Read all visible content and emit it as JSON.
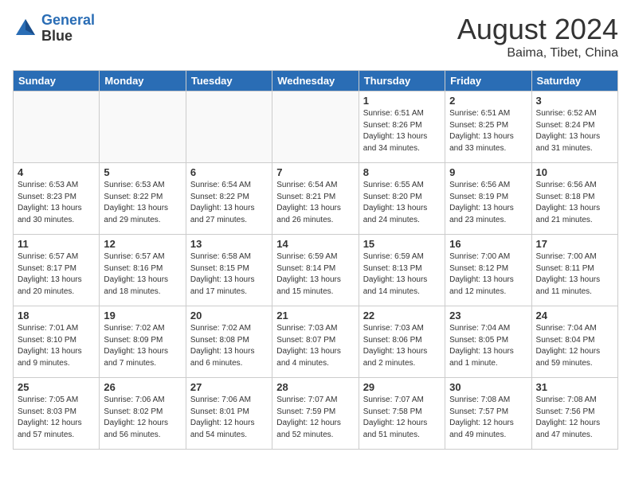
{
  "header": {
    "logo_line1": "General",
    "logo_line2": "Blue",
    "month_year": "August 2024",
    "location": "Baima, Tibet, China"
  },
  "weekdays": [
    "Sunday",
    "Monday",
    "Tuesday",
    "Wednesday",
    "Thursday",
    "Friday",
    "Saturday"
  ],
  "weeks": [
    [
      {
        "day": "",
        "info": ""
      },
      {
        "day": "",
        "info": ""
      },
      {
        "day": "",
        "info": ""
      },
      {
        "day": "",
        "info": ""
      },
      {
        "day": "1",
        "info": "Sunrise: 6:51 AM\nSunset: 8:26 PM\nDaylight: 13 hours\nand 34 minutes."
      },
      {
        "day": "2",
        "info": "Sunrise: 6:51 AM\nSunset: 8:25 PM\nDaylight: 13 hours\nand 33 minutes."
      },
      {
        "day": "3",
        "info": "Sunrise: 6:52 AM\nSunset: 8:24 PM\nDaylight: 13 hours\nand 31 minutes."
      }
    ],
    [
      {
        "day": "4",
        "info": "Sunrise: 6:53 AM\nSunset: 8:23 PM\nDaylight: 13 hours\nand 30 minutes."
      },
      {
        "day": "5",
        "info": "Sunrise: 6:53 AM\nSunset: 8:22 PM\nDaylight: 13 hours\nand 29 minutes."
      },
      {
        "day": "6",
        "info": "Sunrise: 6:54 AM\nSunset: 8:22 PM\nDaylight: 13 hours\nand 27 minutes."
      },
      {
        "day": "7",
        "info": "Sunrise: 6:54 AM\nSunset: 8:21 PM\nDaylight: 13 hours\nand 26 minutes."
      },
      {
        "day": "8",
        "info": "Sunrise: 6:55 AM\nSunset: 8:20 PM\nDaylight: 13 hours\nand 24 minutes."
      },
      {
        "day": "9",
        "info": "Sunrise: 6:56 AM\nSunset: 8:19 PM\nDaylight: 13 hours\nand 23 minutes."
      },
      {
        "day": "10",
        "info": "Sunrise: 6:56 AM\nSunset: 8:18 PM\nDaylight: 13 hours\nand 21 minutes."
      }
    ],
    [
      {
        "day": "11",
        "info": "Sunrise: 6:57 AM\nSunset: 8:17 PM\nDaylight: 13 hours\nand 20 minutes."
      },
      {
        "day": "12",
        "info": "Sunrise: 6:57 AM\nSunset: 8:16 PM\nDaylight: 13 hours\nand 18 minutes."
      },
      {
        "day": "13",
        "info": "Sunrise: 6:58 AM\nSunset: 8:15 PM\nDaylight: 13 hours\nand 17 minutes."
      },
      {
        "day": "14",
        "info": "Sunrise: 6:59 AM\nSunset: 8:14 PM\nDaylight: 13 hours\nand 15 minutes."
      },
      {
        "day": "15",
        "info": "Sunrise: 6:59 AM\nSunset: 8:13 PM\nDaylight: 13 hours\nand 14 minutes."
      },
      {
        "day": "16",
        "info": "Sunrise: 7:00 AM\nSunset: 8:12 PM\nDaylight: 13 hours\nand 12 minutes."
      },
      {
        "day": "17",
        "info": "Sunrise: 7:00 AM\nSunset: 8:11 PM\nDaylight: 13 hours\nand 11 minutes."
      }
    ],
    [
      {
        "day": "18",
        "info": "Sunrise: 7:01 AM\nSunset: 8:10 PM\nDaylight: 13 hours\nand 9 minutes."
      },
      {
        "day": "19",
        "info": "Sunrise: 7:02 AM\nSunset: 8:09 PM\nDaylight: 13 hours\nand 7 minutes."
      },
      {
        "day": "20",
        "info": "Sunrise: 7:02 AM\nSunset: 8:08 PM\nDaylight: 13 hours\nand 6 minutes."
      },
      {
        "day": "21",
        "info": "Sunrise: 7:03 AM\nSunset: 8:07 PM\nDaylight: 13 hours\nand 4 minutes."
      },
      {
        "day": "22",
        "info": "Sunrise: 7:03 AM\nSunset: 8:06 PM\nDaylight: 13 hours\nand 2 minutes."
      },
      {
        "day": "23",
        "info": "Sunrise: 7:04 AM\nSunset: 8:05 PM\nDaylight: 13 hours\nand 1 minute."
      },
      {
        "day": "24",
        "info": "Sunrise: 7:04 AM\nSunset: 8:04 PM\nDaylight: 12 hours\nand 59 minutes."
      }
    ],
    [
      {
        "day": "25",
        "info": "Sunrise: 7:05 AM\nSunset: 8:03 PM\nDaylight: 12 hours\nand 57 minutes."
      },
      {
        "day": "26",
        "info": "Sunrise: 7:06 AM\nSunset: 8:02 PM\nDaylight: 12 hours\nand 56 minutes."
      },
      {
        "day": "27",
        "info": "Sunrise: 7:06 AM\nSunset: 8:01 PM\nDaylight: 12 hours\nand 54 minutes."
      },
      {
        "day": "28",
        "info": "Sunrise: 7:07 AM\nSunset: 7:59 PM\nDaylight: 12 hours\nand 52 minutes."
      },
      {
        "day": "29",
        "info": "Sunrise: 7:07 AM\nSunset: 7:58 PM\nDaylight: 12 hours\nand 51 minutes."
      },
      {
        "day": "30",
        "info": "Sunrise: 7:08 AM\nSunset: 7:57 PM\nDaylight: 12 hours\nand 49 minutes."
      },
      {
        "day": "31",
        "info": "Sunrise: 7:08 AM\nSunset: 7:56 PM\nDaylight: 12 hours\nand 47 minutes."
      }
    ]
  ]
}
